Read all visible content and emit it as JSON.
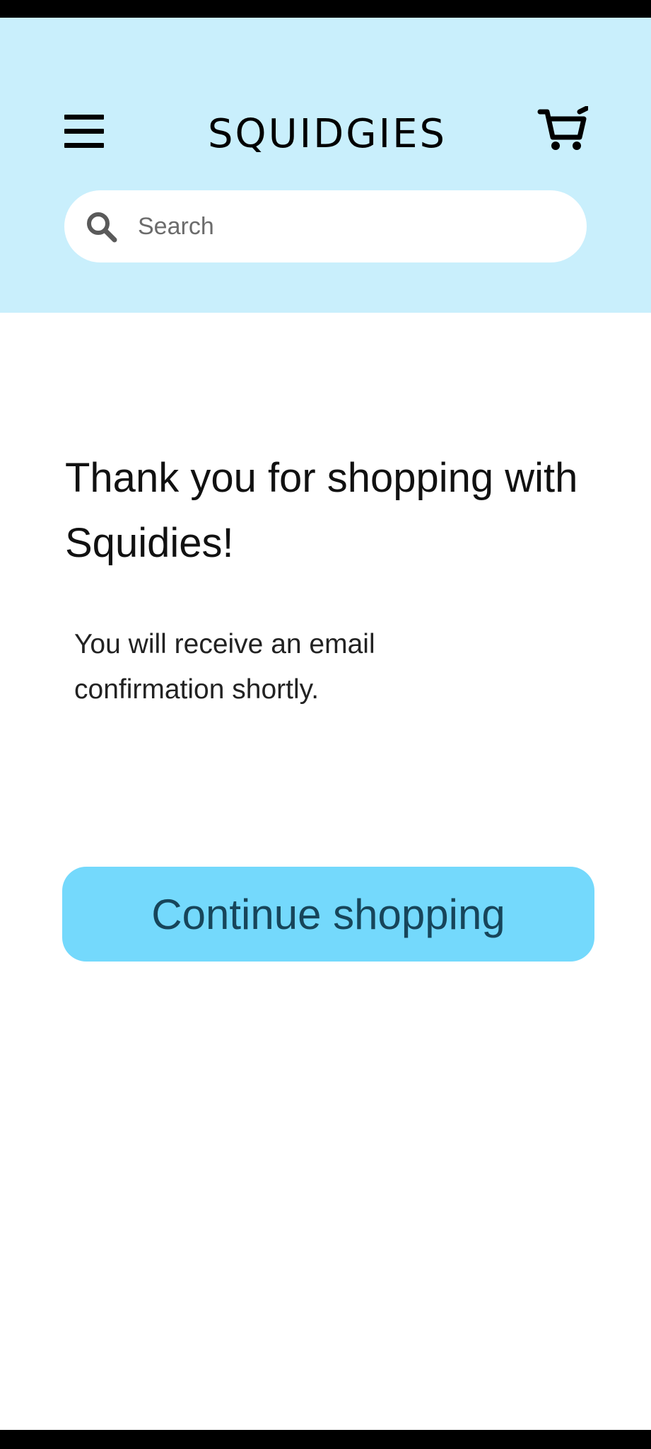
{
  "app": {
    "logo_text": "SQUIDGIES"
  },
  "header": {
    "background_color": "#c9effc",
    "menu_icon": "hamburger-menu-icon",
    "cart_icon": "shopping-cart-icon"
  },
  "search": {
    "placeholder": "Search",
    "value": "",
    "icon": "search-icon"
  },
  "confirmation": {
    "heading": "Thank you for shopping with Squidies!",
    "message": "You will receive an email confirmation shortly."
  },
  "actions": {
    "continue_label": "Continue shopping",
    "continue_color": "#74d9fc"
  }
}
